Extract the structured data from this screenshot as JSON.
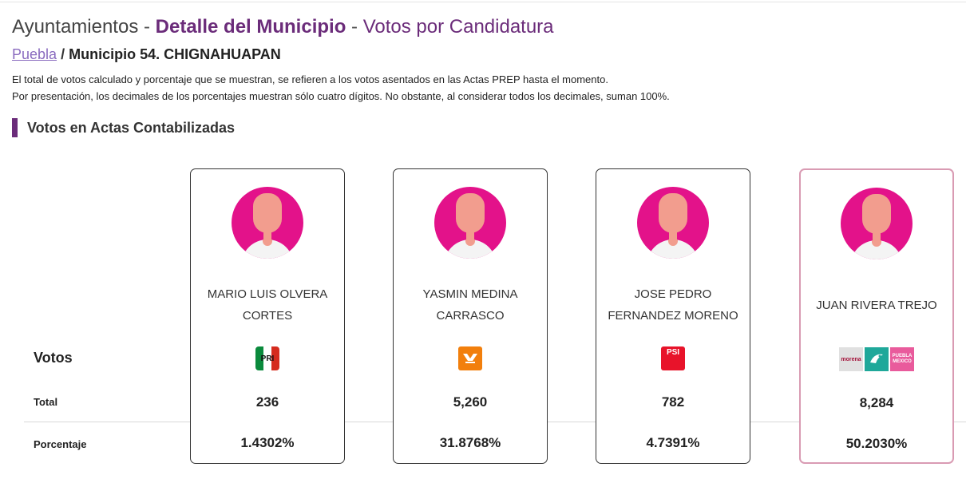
{
  "header": {
    "section": "Ayuntamientos",
    "sep1": " - ",
    "detail": "Detalle del Municipio",
    "sep2": " - ",
    "view": "Votos por Candidatura"
  },
  "breadcrumb": {
    "state_link": "Puebla",
    "slash": " / ",
    "municipality": "Municipio 54. CHIGNAHUAPAN"
  },
  "notes": [
    "El total de votos calculado y porcentaje que se muestran, se refieren a los votos asentados en las Actas PREP hasta el momento.",
    "Por presentación, los decimales de los porcentajes muestran sólo cuatro dígitos. No obstante, al considerar todos los decimales, suman 100%."
  ],
  "section_title": "Votos en Actas Contabilizadas",
  "row_labels": {
    "votos": "Votos",
    "total": "Total",
    "porcentaje": "Porcentaje"
  },
  "candidates": [
    {
      "name_line1": "MARIO LUIS OLVERA",
      "name_line2": "CORTES",
      "party_logos": [
        "pri-logo"
      ],
      "total": "236",
      "percentage": "1.4302%"
    },
    {
      "name_line1": "YASMIN MEDINA",
      "name_line2": "CARRASCO",
      "party_logos": [
        "mc-logo"
      ],
      "total": "5,260",
      "percentage": "31.8768%"
    },
    {
      "name_line1": "JOSE PEDRO",
      "name_line2": "FERNANDEZ MORENO",
      "party_logos": [
        "psi-logo"
      ],
      "total": "782",
      "percentage": "4.7391%"
    },
    {
      "name_line1": "JUAN RIVERA TREJO",
      "name_line2": "",
      "party_logos": [
        "morena-logo",
        "pvem-logo",
        "pmp-logo"
      ],
      "total": "8,284",
      "percentage": "50.2030%"
    }
  ],
  "logo_text": {
    "pri": "PRI",
    "psi": "PSI",
    "morena": "morena",
    "pmp": "PUEBLA MEXICO"
  },
  "colors": {
    "accent_purple": "#6b2c7a",
    "link": "#8a6bbf",
    "winner_border": "#d99bb3",
    "avatar_bg": "#e3128a"
  }
}
